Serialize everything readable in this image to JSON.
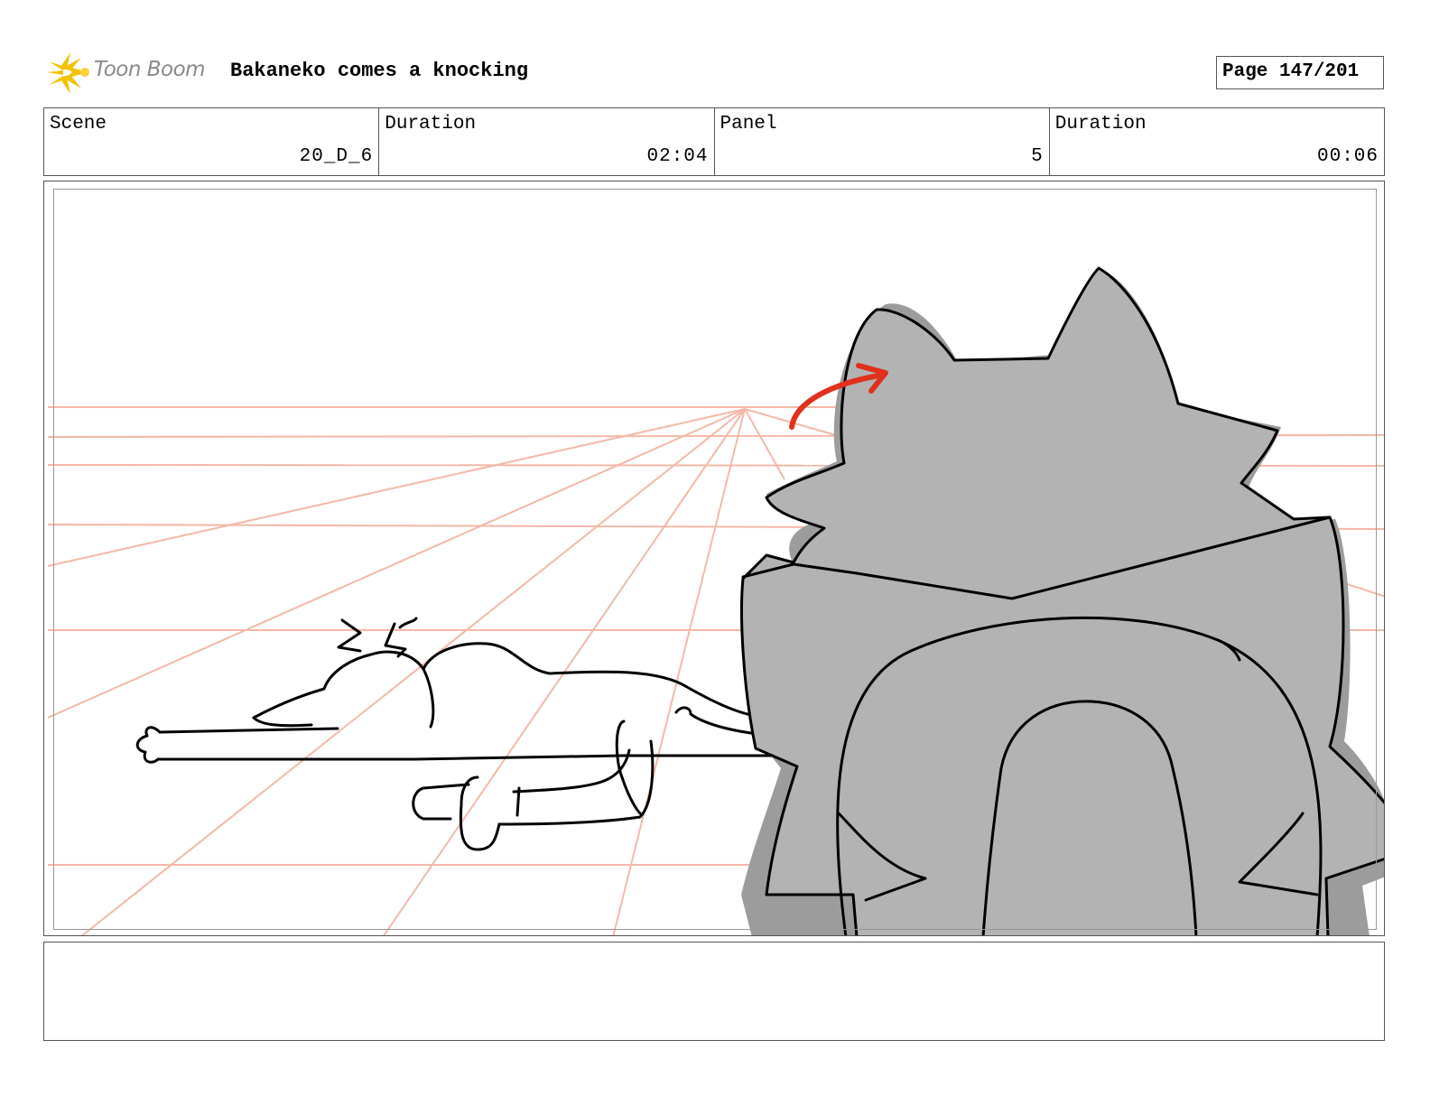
{
  "header": {
    "logo_text": "Toon Boom",
    "title": "Bakaneko comes a knocking",
    "page": "Page 147/201"
  },
  "info": [
    {
      "label": "Scene",
      "value": "20_D_6"
    },
    {
      "label": "Duration",
      "value": "02:04"
    },
    {
      "label": "Panel",
      "value": "5"
    },
    {
      "label": "Duration",
      "value": "00:06"
    }
  ],
  "panel": {
    "drawing": "storyboard-sketch",
    "colors": {
      "perspective_lines": "#f3b8a8",
      "cat_fill": "#b3b3b3",
      "cat_shadow": "#9c9c9c",
      "arrow": "#e0301e",
      "ink": "#000000"
    }
  },
  "notes": {
    "text": ""
  }
}
